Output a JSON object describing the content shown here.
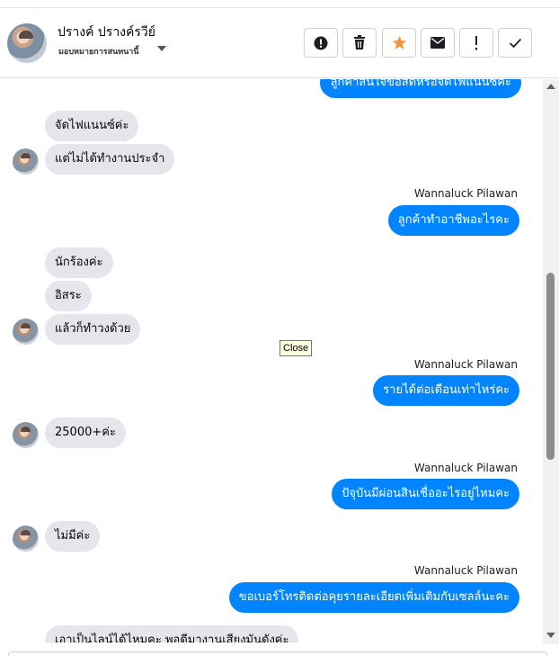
{
  "header": {
    "name": "ปรางค์ ปรางค์รวีย์",
    "assignee": "มอบหมายการสนทนานี้"
  },
  "toolbar": [
    {
      "name": "spam-button",
      "icon": "alert-circle-icon"
    },
    {
      "name": "delete-button",
      "icon": "trash-icon"
    },
    {
      "name": "star-button",
      "icon": "star-icon",
      "color": "#f7923a"
    },
    {
      "name": "mark-unread-button",
      "icon": "envelope-icon"
    },
    {
      "name": "follow-up-button",
      "icon": "exclamation-icon"
    },
    {
      "name": "mark-done-button",
      "icon": "check-icon"
    }
  ],
  "messages": {
    "m0": "ลูกค้าสนใจขอสัดหรือจัดไฟแนนซ์คะ",
    "m1": "จัดไฟแนนซ์ค่ะ",
    "m2": "แต่ไม่ได้ทำงานประจำ",
    "s1": "Wannaluck Pilawan",
    "m3": "ลูกค้าทำอาชีพอะไรคะ",
    "m4": "นักร้องค่ะ",
    "m5": "อิสระ",
    "m6": "แล้วก็ทำวงด้วย",
    "s2": "Wannaluck Pilawan",
    "m7": "รายได้ต่อเดือนเท่าไหร่คะ",
    "m8": "25000+ค่ะ",
    "s3": "Wannaluck Pilawan",
    "m9": "ปัจุบันมีผ่อนสินเชื่ออะไรอยู่ไหมคะ",
    "m10": "ไม่มีค่ะ",
    "s4": "Wannaluck Pilawan",
    "m11": "ขอเบอร์โทรติดต่อคุยรายละเอียดเพิ่มเติมกับเซลล์นะคะ",
    "m12": "เอาเป็นไลน์ได้ไหมคะ พอดีมางานเสียงมันดังค่ะ"
  },
  "tooltip": "Close",
  "colors": {
    "outgoing": "#0084ff",
    "incoming": "#e4e6eb",
    "star": "#f7923a"
  }
}
